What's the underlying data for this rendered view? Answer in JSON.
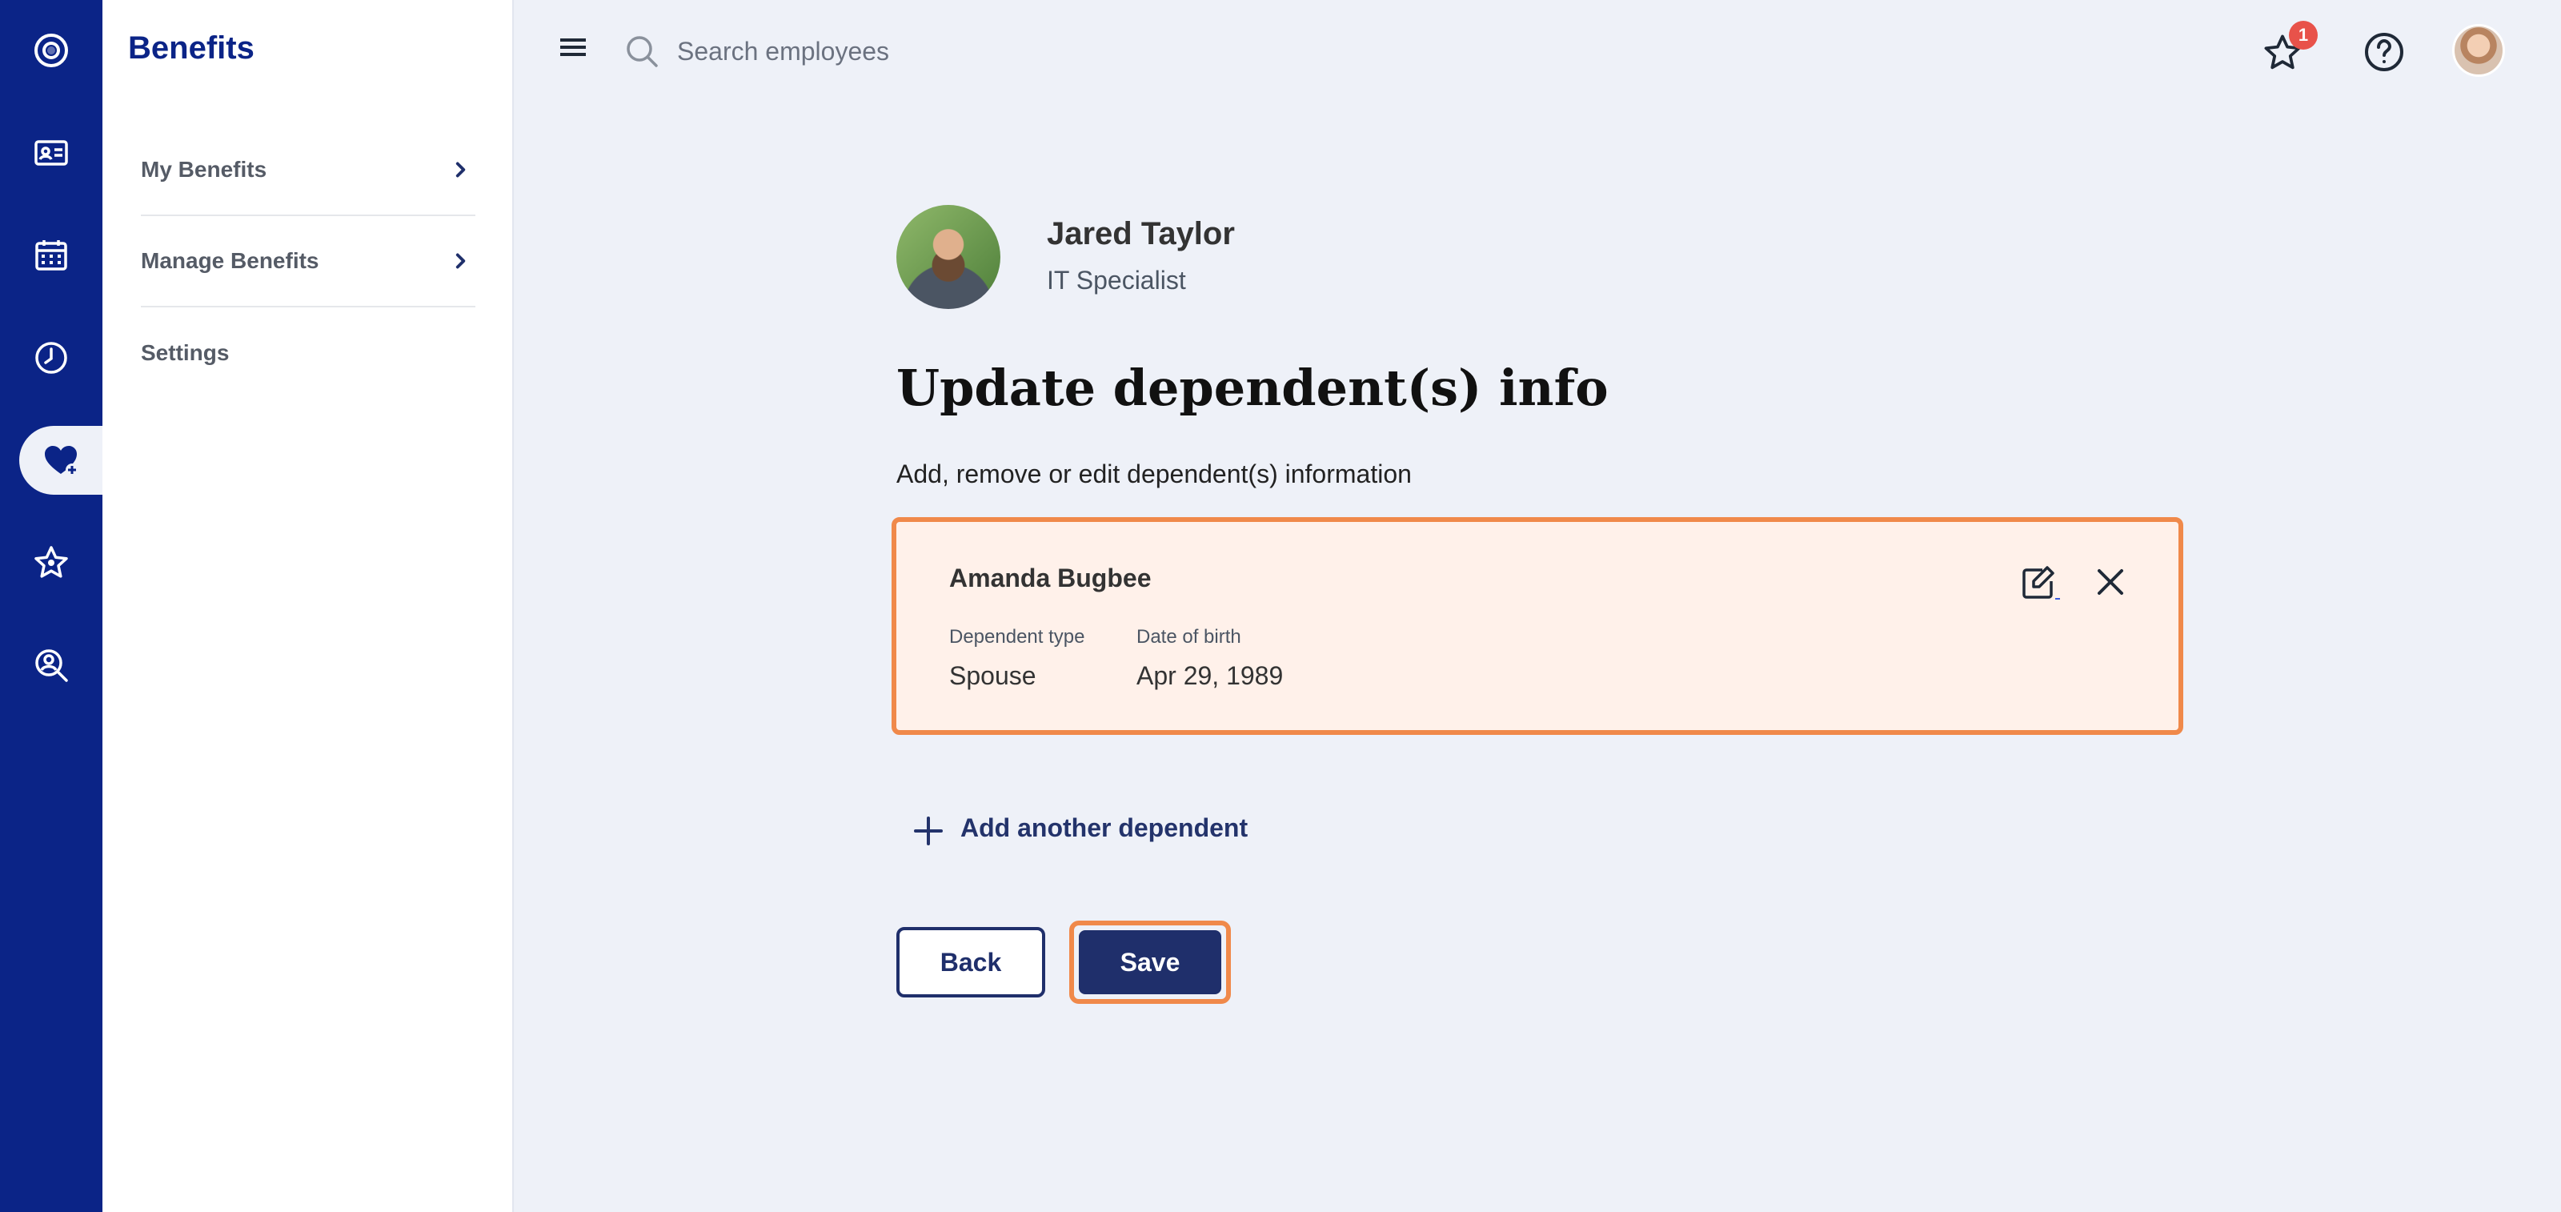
{
  "sidebar": {
    "title": "Benefits",
    "items": [
      {
        "label": "My Benefits"
      },
      {
        "label": "Manage Benefits"
      },
      {
        "label": "Settings"
      }
    ]
  },
  "rail": {
    "icons": [
      "logo-icon",
      "id-card-icon",
      "calendar-icon",
      "clock-icon",
      "heart-plus-icon",
      "star-icon",
      "search-person-icon"
    ],
    "active": "heart-plus-icon"
  },
  "topbar": {
    "search_placeholder": "Search employees",
    "notification_count": "1"
  },
  "employee": {
    "name": "Jared Taylor",
    "role": "IT Specialist"
  },
  "page": {
    "title": "Update dependent(s) info",
    "subtitle": "Add, remove or edit dependent(s) information"
  },
  "dependent": {
    "name": "Amanda Bugbee",
    "type_label": "Dependent type",
    "type_value": "Spouse",
    "dob_label": "Date of birth",
    "dob_value": "Apr 29, 1989"
  },
  "actions": {
    "add_label": "Add another dependent",
    "back_label": "Back",
    "save_label": "Save"
  },
  "colors": {
    "brand": "#0b2487",
    "highlight": "#f0894a",
    "card_bg": "#fff1ea",
    "button": "#1f2f6b",
    "badge": "#e8524a"
  }
}
